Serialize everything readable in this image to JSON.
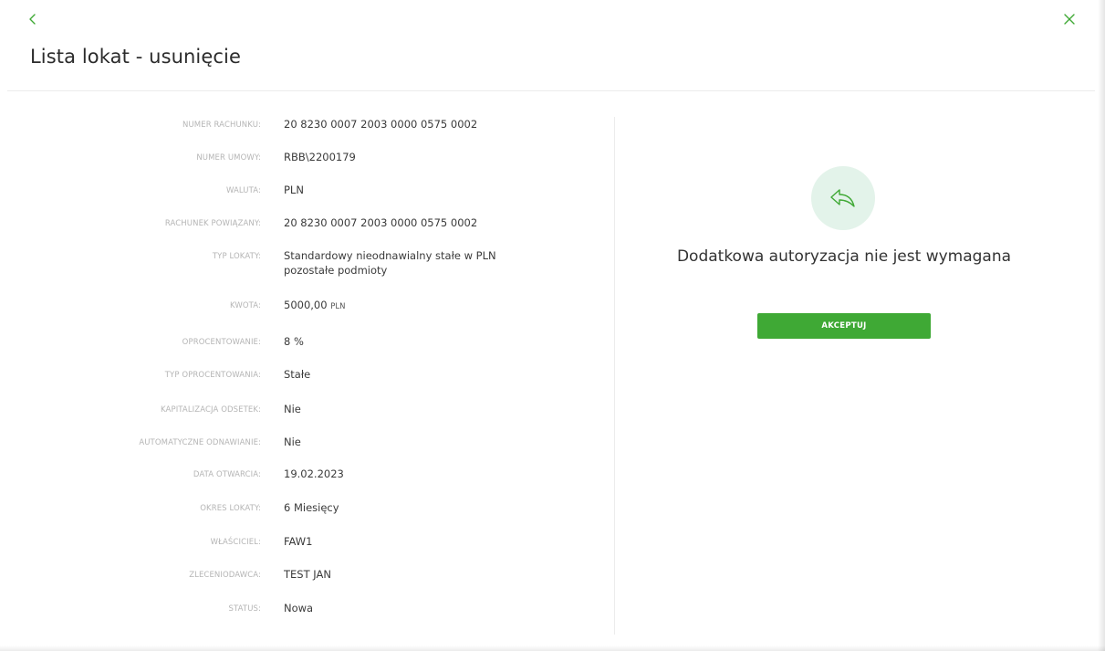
{
  "header": {
    "title": "Lista lokat - usunięcie",
    "back_icon": "chevron-left-icon",
    "close_icon": "close-icon",
    "accent_color": "#3fa935"
  },
  "details": [
    {
      "label": "NUMER RACHUNKU:",
      "value": "20 8230 0007 2003 0000 0575 0002"
    },
    {
      "label": "NUMER UMOWY:",
      "value": "RBB\\2200179"
    },
    {
      "label": "WALUTA:",
      "value": "PLN"
    },
    {
      "label": "RACHUNEK POWIĄZANY:",
      "value": "20 8230 0007 2003 0000 0575 0002"
    },
    {
      "label": "TYP LOKATY:",
      "value": "Standardowy nieodnawialny stałe w PLN",
      "value_line2": "pozostałe podmioty"
    },
    {
      "label": "KWOTA:",
      "value": "5000,00",
      "unit": "PLN"
    },
    {
      "label": "OPROCENTOWANIE:",
      "value": "8 %"
    },
    {
      "label": "TYP OPROCENTOWANIA:",
      "value": "Stałe"
    },
    {
      "label": "KAPITALIZACJA ODSETEK:",
      "value": "Nie"
    },
    {
      "label": "AUTOMATYCZNE ODNAWIANIE:",
      "value": "Nie"
    },
    {
      "label": "DATA OTWARCIA:",
      "value": "19.02.2023"
    },
    {
      "label": "OKRES LOKATY:",
      "value": "6 Miesięcy"
    },
    {
      "label": "WŁAŚCICIEL:",
      "value": "FAW1"
    },
    {
      "label": "ZLECENIODAWCA:",
      "value": "TEST JAN"
    },
    {
      "label": "STATUS:",
      "value": "Nowa"
    }
  ],
  "authorization": {
    "icon": "reply-arrow-icon",
    "message": "Dodatkowa autoryzacja nie jest wymagana",
    "accept_label": "AKCEPTUJ"
  }
}
